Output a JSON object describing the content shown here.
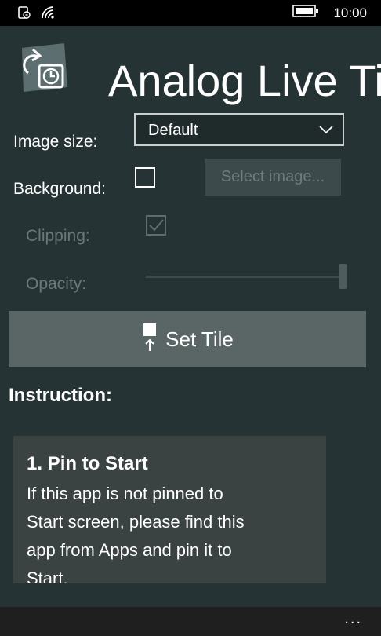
{
  "status_bar": {
    "time": "10:00",
    "icons": [
      "rotation-lock-icon",
      "wifi-icon",
      "battery-icon"
    ]
  },
  "app": {
    "title": "Analog Live Ti",
    "logo_icon": "rotating-clock-tile-icon"
  },
  "settings": {
    "image_size": {
      "label": "Image size:",
      "value": "Default"
    },
    "background": {
      "label": "Background:",
      "checked": false,
      "select_button": "Select image..."
    },
    "clipping": {
      "label": "Clipping:",
      "checked": true,
      "enabled": false
    },
    "opacity": {
      "label": "Opacity:",
      "value_fraction": 1.0,
      "enabled": false
    }
  },
  "set_tile": {
    "label": "Set Tile",
    "icon": "pin-tile-icon"
  },
  "instruction": {
    "heading": "Instruction:",
    "cards": [
      {
        "title": "1. Pin to Start",
        "body_lines": [
          "If this app is not pinned to",
          "Start screen, please find this",
          "app from Apps and pin it to",
          "Start."
        ]
      }
    ]
  },
  "app_bar": {
    "more": "..."
  },
  "colors": {
    "background": "#263334",
    "status_bar": "#000000",
    "set_tile_button": "#5a6565",
    "card": "#3a4242",
    "disabled_text": "#6c7879"
  }
}
